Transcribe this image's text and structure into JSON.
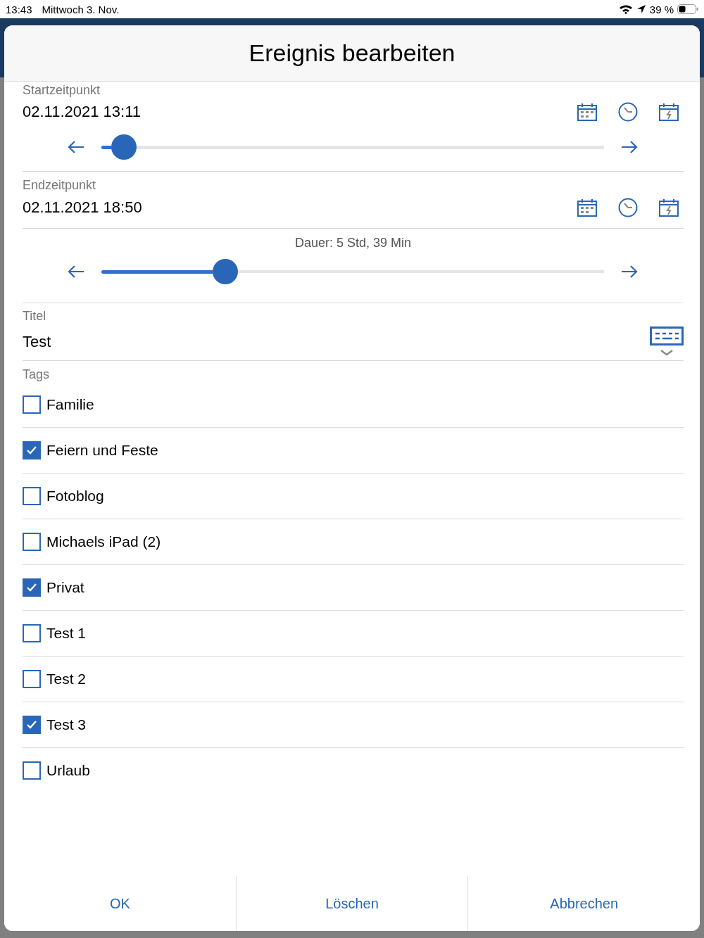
{
  "status_bar": {
    "time": "13:43",
    "date": "Mittwoch 3. Nov.",
    "battery": "39 %"
  },
  "dialog": {
    "title": "Ereignis bearbeiten",
    "start": {
      "label": "Startzeitpunkt",
      "value": "02.11.2021 13:11",
      "level": 0.045
    },
    "end": {
      "label": "Endzeitpunkt",
      "value": "02.11.2021 18:50",
      "duration": "Dauer: 5 Std, 39 Min",
      "level": 0.247
    },
    "title_field": {
      "label": "Titel",
      "value": "Test"
    },
    "tags": {
      "label": "Tags",
      "items": [
        {
          "label": "Familie",
          "checked": false
        },
        {
          "label": "Feiern und Feste",
          "checked": true
        },
        {
          "label": "Fotoblog",
          "checked": false
        },
        {
          "label": "Michaels iPad (2)",
          "checked": false
        },
        {
          "label": "Privat",
          "checked": true
        },
        {
          "label": "Test 1",
          "checked": false
        },
        {
          "label": "Test 2",
          "checked": false
        },
        {
          "label": "Test 3",
          "checked": true
        },
        {
          "label": "Urlaub",
          "checked": false
        }
      ]
    },
    "buttons": [
      "OK",
      "Löschen",
      "Abbrechen"
    ]
  }
}
